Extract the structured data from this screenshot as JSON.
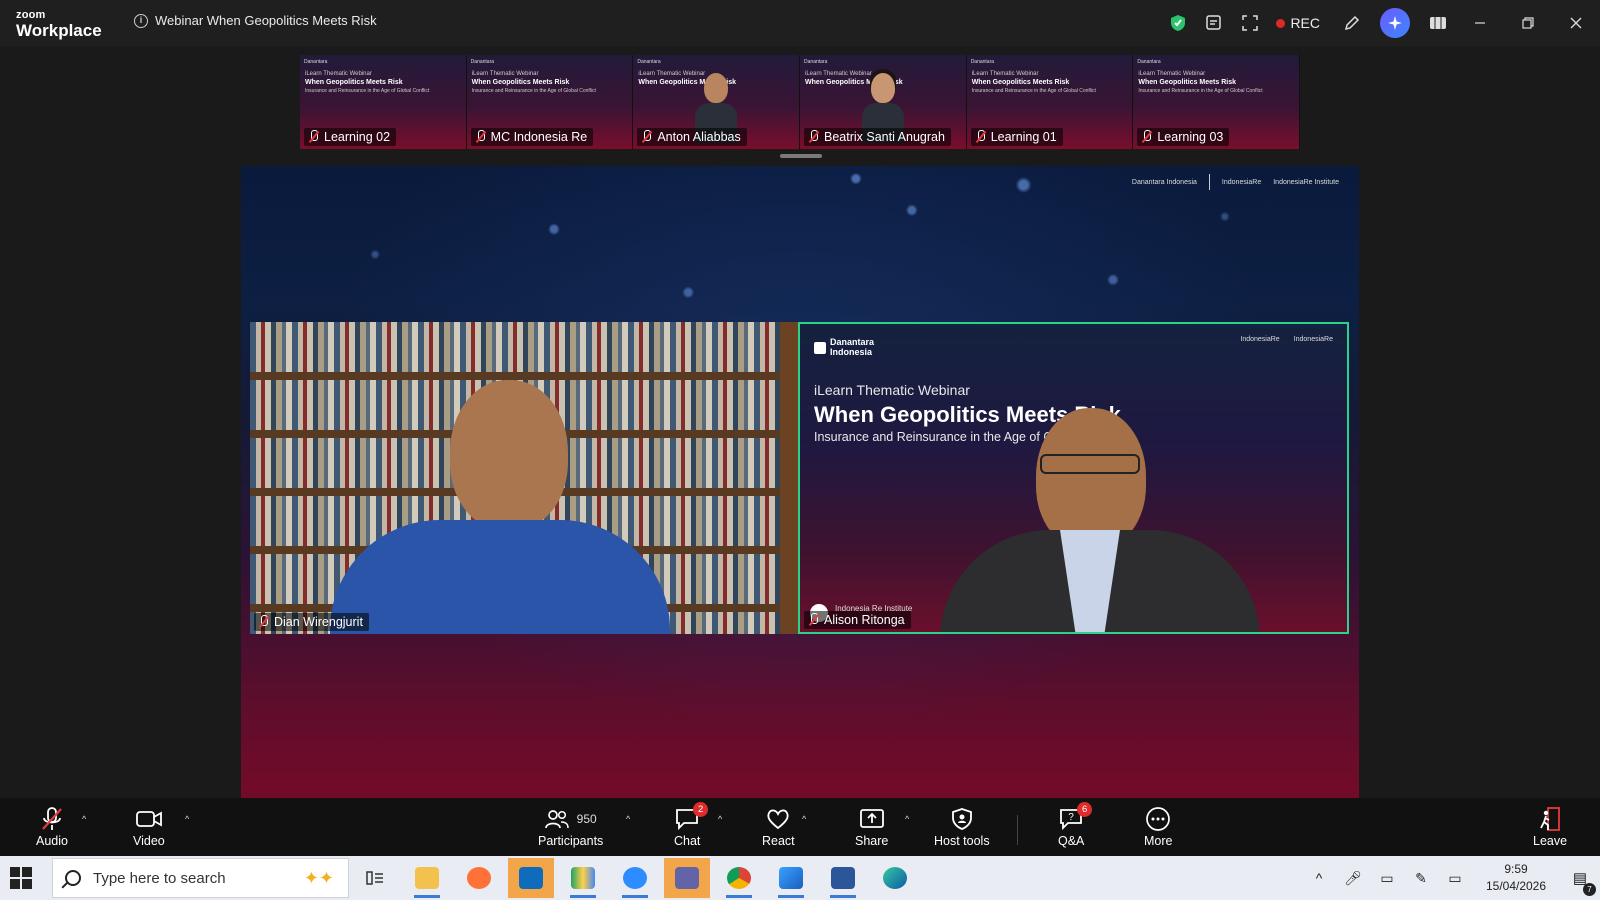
{
  "window": {
    "logo_top": "zoom",
    "logo_bottom": "Workplace",
    "meeting_title": "Webinar When Geopolitics Meets Risk",
    "rec_label": "REC"
  },
  "gallery": [
    {
      "name": "Learning 02",
      "kind": "slide"
    },
    {
      "name": "MC Indonesia Re",
      "kind": "slide"
    },
    {
      "name": "Anton Aliabbas",
      "kind": "person"
    },
    {
      "name": "Beatrix Santi Anugrah",
      "kind": "person"
    },
    {
      "name": "Learning 01",
      "kind": "slide"
    },
    {
      "name": "Learning 03",
      "kind": "slide"
    }
  ],
  "thumb_slide": {
    "brand": "Danantara",
    "line1": "iLearn Thematic Webinar",
    "line2": "When Geopolitics Meets Risk",
    "line3": "Insurance and Reinsurance in the Age of Global Conflict"
  },
  "share": {
    "logo_left": "Danantara Indonesia",
    "logo_mid": "IndonesiaRe",
    "logo_right": "IndonesiaRe Institute"
  },
  "tiles": {
    "left_name": "Dian Wirengjurit",
    "right_name": "Alison Ritonga",
    "right_institute": "Indonesia Re Institute",
    "slide_brand_1": "Danantara",
    "slide_brand_2": "Indonesia",
    "slide_logo_r1": "IndonesiaRe",
    "slide_logo_r2": "IndonesiaRe",
    "slide_line1": "iLearn Thematic Webinar",
    "slide_line2": "When Geopolitics Meets Risk",
    "slide_line3": "Insurance and Reinsurance in the Age of Global Conflict"
  },
  "toolbar": {
    "audio": "Audio",
    "video": "Video",
    "participants": "Participants",
    "participants_count": "950",
    "chat": "Chat",
    "chat_badge": "2",
    "react": "React",
    "share": "Share",
    "host_tools": "Host tools",
    "qa": "Q&A",
    "qa_badge": "6",
    "more": "More",
    "leave": "Leave"
  },
  "taskbar": {
    "search_placeholder": "Type here to search",
    "time": "9:59",
    "date": "15/04/2026",
    "notif_count": "7"
  },
  "colors": {
    "speaker_border": "#2bd38a",
    "rec_dot": "#e02828",
    "mic_off": "#e23d3d",
    "badge": "#e02b2b"
  }
}
